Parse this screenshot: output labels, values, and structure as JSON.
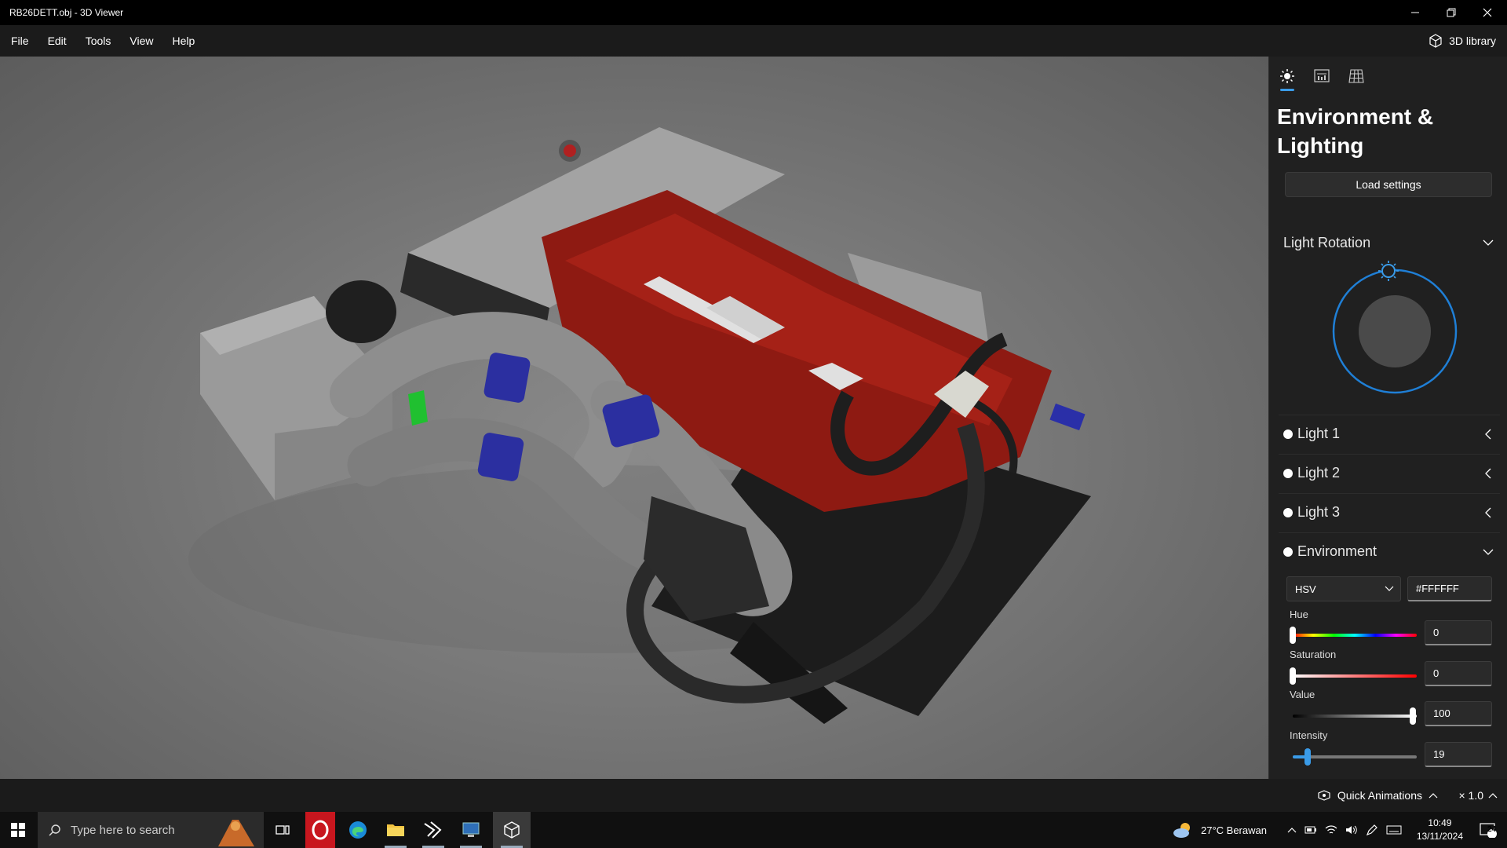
{
  "window": {
    "title": "RB26DETT.obj - 3D Viewer",
    "minimize_icon": "minimize-icon",
    "restore_icon": "restore-icon",
    "close_icon": "close-icon"
  },
  "menubar": {
    "items": [
      "File",
      "Edit",
      "Tools",
      "View",
      "Help"
    ],
    "library_label": "3D library"
  },
  "panel": {
    "tabs": [
      "sun-icon",
      "stats-icon",
      "grid-icon"
    ],
    "title": "Environment & Lighting",
    "load_button": "Load settings",
    "light_rotation_label": "Light Rotation",
    "lights": [
      "Light 1",
      "Light 2",
      "Light 3"
    ],
    "environment_label": "Environment",
    "color_mode": "HSV",
    "hex_value": "#FFFFFF",
    "hue_label": "Hue",
    "hue_value": "0",
    "saturation_label": "Saturation",
    "saturation_value": "0",
    "value_label": "Value",
    "value_value": "100",
    "intensity_label": "Intensity",
    "intensity_value": "19"
  },
  "statusbar": {
    "quick_animations": "Quick Animations",
    "speed": "× 1.0"
  },
  "taskbar": {
    "search_placeholder": "Type here to search",
    "weather": "27°C  Berawan",
    "time": "10:49",
    "date": "13/11/2024",
    "notification_count": "24"
  },
  "colors": {
    "accent": "#3a9be8",
    "panel_bg": "#202020",
    "engine_red": "#8e1a12"
  }
}
